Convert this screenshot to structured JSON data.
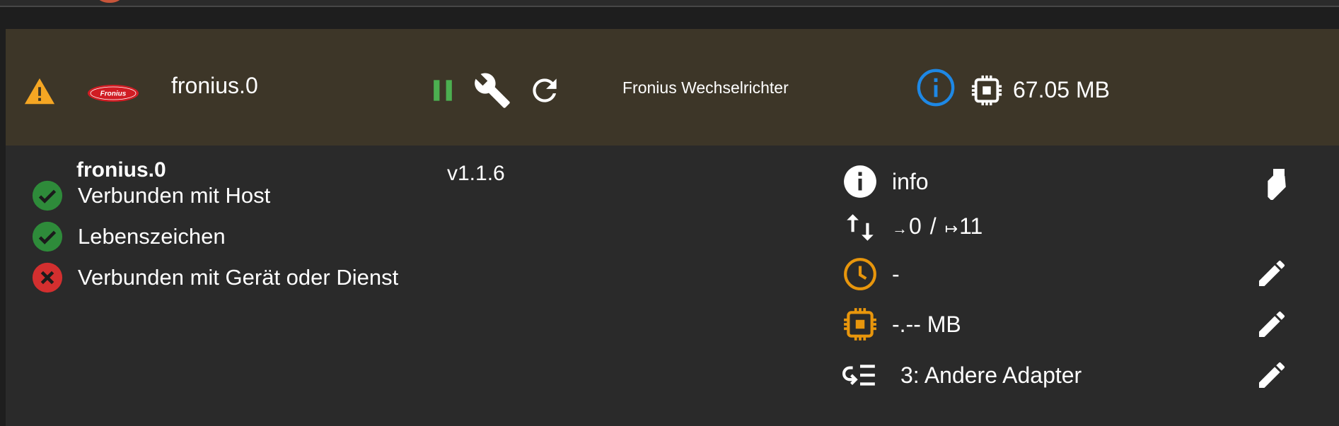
{
  "header": {
    "instance_name": "fronius.0",
    "description": "Fronius Wechselrichter",
    "memory": "67.05 MB",
    "brand_logo_text": "Fronius"
  },
  "details": {
    "title": "fronius.0",
    "version": "v1.1.6",
    "status": [
      {
        "label": "Verbunden mit Host",
        "state": "ok"
      },
      {
        "label": "Lebenszeichen",
        "state": "ok"
      },
      {
        "label": "Verbunden mit Gerät oder Dienst",
        "state": "error"
      }
    ],
    "loglevel": "info",
    "events_in": "0",
    "events_sep": "/",
    "events_out": "11",
    "schedule": "-",
    "ram_limit": "-.-- MB",
    "start_order": "3: Andere Adapter"
  },
  "icons": {
    "warning": "warning-triangle-icon",
    "pause": "pause-icon",
    "settings": "wrench-icon",
    "restart": "reload-icon",
    "info": "info-circle-icon",
    "memory": "chip-icon",
    "ok": "check-circle-icon",
    "error": "close-circle-icon",
    "events": "swap-vertical-icon",
    "schedule": "clock-icon",
    "order": "sort-order-icon",
    "edit": "pencil-icon",
    "cleanup": "eraser-icon"
  },
  "colors": {
    "header_bg": "#3d3628",
    "panel_bg": "#2a2a2a",
    "warning": "#f5a623",
    "pause_green": "#4caf50",
    "info_blue": "#1e88e5",
    "ok_green": "#2e8b3a",
    "error_red": "#d32f2f",
    "accent_orange": "#e8960c"
  }
}
